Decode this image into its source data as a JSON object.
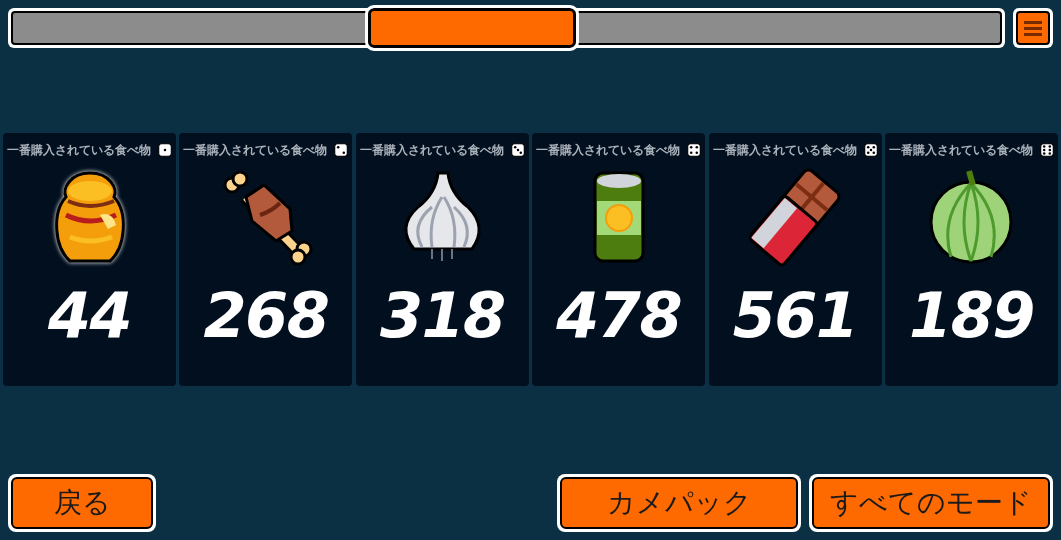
{
  "pager": {
    "level": 0.465
  },
  "cards": [
    {
      "label": "一番購入されている食べ物",
      "kind": "honey",
      "count": "44"
    },
    {
      "label": "一番購入されている食べ物",
      "kind": "meat",
      "count": "268"
    },
    {
      "label": "一番購入されている食べ物",
      "kind": "garlic",
      "count": "318"
    },
    {
      "label": "一番購入されている食べ物",
      "kind": "can",
      "count": "478"
    },
    {
      "label": "一番購入されている食べ物",
      "kind": "chocolate",
      "count": "561"
    },
    {
      "label": "一番購入されている食べ物",
      "kind": "melon",
      "count": "189"
    }
  ],
  "buttons": {
    "back": "戻る",
    "right": [
      "カメパック",
      "すべてのモード"
    ]
  }
}
